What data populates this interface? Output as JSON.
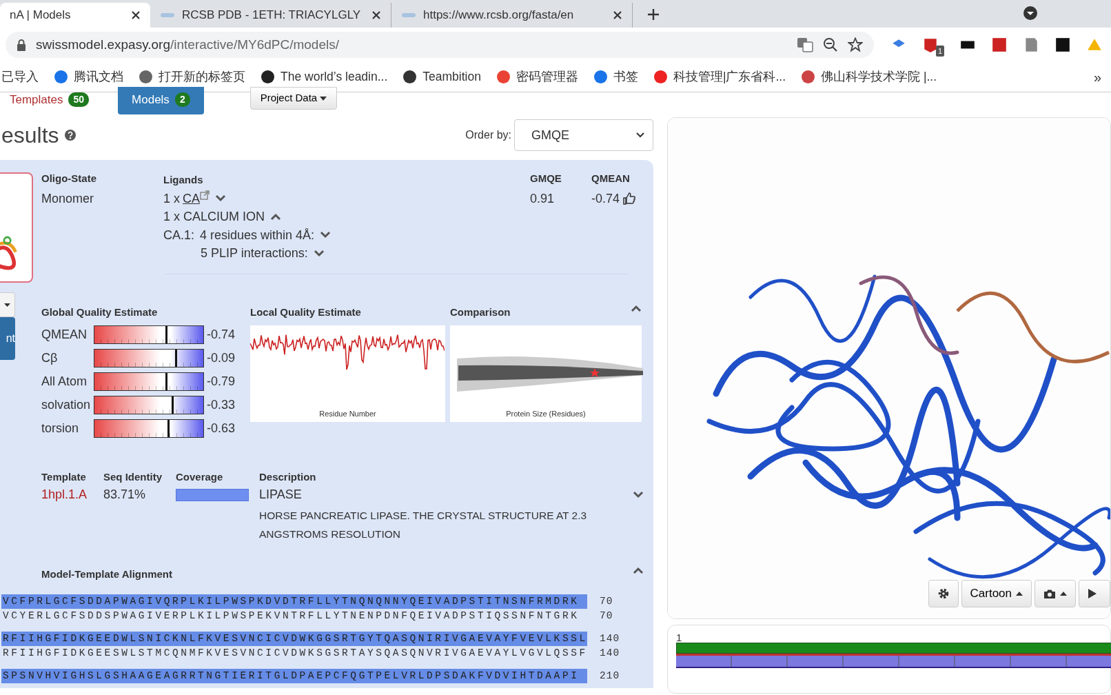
{
  "browser": {
    "tabs": [
      {
        "title": "nA | Models",
        "selected": true
      },
      {
        "title": "RCSB PDB - 1ETH: TRIACYLGLY",
        "selected": false
      },
      {
        "title": "https://www.rcsb.org/fasta/en",
        "selected": false
      }
    ],
    "address": {
      "host": "swissmodel.expasy.org",
      "path": "/interactive/MY6dPC/models/"
    },
    "extension_badge": "1",
    "bookmarks": [
      "已导入",
      "腾讯文档",
      "打开新的标签页",
      "The world’s leadin...",
      "Teambition",
      "密码管理器",
      "书签",
      "科技管理|广东省科...",
      "佛山科学技术学院 |..."
    ],
    "more": "»"
  },
  "nav_tabs": [
    {
      "label": "Templates",
      "count": "50",
      "selected": false
    },
    {
      "label": "Models",
      "count": "2",
      "selected": true
    }
  ],
  "project_button": "Project Data",
  "heading": "esults",
  "order_by": {
    "label": "Order by:",
    "value": "GMQE"
  },
  "side_button": "nt",
  "model": {
    "oligo": {
      "label": "Oligo-State",
      "value": "Monomer"
    },
    "ligands": {
      "label": "Ligands",
      "count": "1 x",
      "link": "CA",
      "name": "1 x CALCIUM ION",
      "site": "CA.1:",
      "residues": "4 residues within 4Å:",
      "plip": "5 PLIP interactions:"
    },
    "gmqe": {
      "label": "GMQE",
      "value": "0.91"
    },
    "qmean": {
      "label": "QMEAN",
      "value": "-0.74"
    }
  },
  "global_quality": {
    "title": "Global Quality Estimate",
    "rows": [
      {
        "name": "QMEAN",
        "level": 0.65,
        "value": "-0.74"
      },
      {
        "name": "Cβ",
        "level": 0.74,
        "value": "-0.09"
      },
      {
        "name": "All Atom",
        "level": 0.65,
        "value": "-0.79"
      },
      {
        "name": "solvation",
        "level": 0.71,
        "value": "-0.33"
      },
      {
        "name": "torsion",
        "level": 0.67,
        "value": "-0.63"
      }
    ]
  },
  "local_quality": {
    "title": "Local Quality Estimate",
    "xlabel": "Residue Number"
  },
  "comparison": {
    "title": "Comparison",
    "xlabel": "Protein Size (Residues)"
  },
  "template": {
    "headers": [
      "Template",
      "Seq Identity",
      "Coverage",
      "Description"
    ],
    "id": "1hpl.1.A",
    "identity": "83.71%",
    "title": "LIPASE",
    "description": "HORSE PANCREATIC LIPASE. THE CRYSTAL STRUCTURE AT 2.3 ANGSTROMS RESOLUTION"
  },
  "alignment": {
    "title": "Model-Template Alignment",
    "rows": [
      {
        "kind": "model",
        "sequence": "VCFPRLGCFSDDAPWAGIVQRPLKILPWSPKDVDTRFLLYTNQNQNNYQEIVADPSTITNSNFRMDRK",
        "number": "70"
      },
      {
        "kind": "template",
        "sequence": "VCYERLGCFSDDSPWAGIVERPLKILPWSPEKVNTRFLLYTNENPDNFQEIVADPSTIQSSNFNTGRK",
        "number": "70"
      },
      {
        "kind": "model",
        "sequence": "RFIIHGFIDKGEEDWLSNICKNLFKVESVNCICVDWKGGSRTGYTQASQNIRIVGAEVAYFVEVLKSSL",
        "number": "140"
      },
      {
        "kind": "template",
        "sequence": "RFIIHGFIDKGEESWLSTMCQNMFKVESVNCICVDWKSGSRTAYSQASQNVRIVGAEVAYLVGVLQSSF",
        "number": "140"
      },
      {
        "kind": "model",
        "sequence": "SPSNVHVIGHSLGSHAAGEAGRRTNGTIERITGLDPAEPCFQGTPELVRLDPSDAKFVDVIHTDAAPI",
        "number": "210"
      }
    ]
  },
  "viewer": {
    "style_button": "Cartoon",
    "track_start": "1"
  }
}
